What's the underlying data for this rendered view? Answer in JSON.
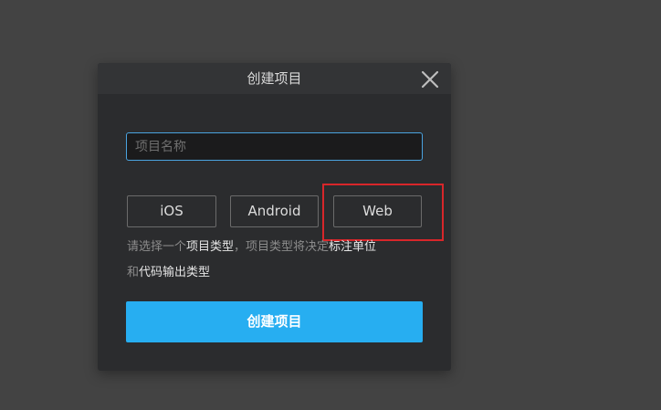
{
  "dialog": {
    "title": "创建项目",
    "close_icon": "close-icon",
    "name_input": {
      "value": "",
      "placeholder": "项目名称"
    },
    "types": [
      {
        "label": "iOS"
      },
      {
        "label": "Android"
      },
      {
        "label": "Web"
      }
    ],
    "hint": {
      "part1": "请选择一个",
      "em1": "项目类型",
      "part2": "，项目类型将决定",
      "em2": "标注单位",
      "part3": "和",
      "em3": "代码输出类型"
    },
    "create_label": "创建项目"
  },
  "colors": {
    "accent": "#27aef1",
    "highlight": "#d8262a",
    "input_border": "#4aa3df"
  }
}
